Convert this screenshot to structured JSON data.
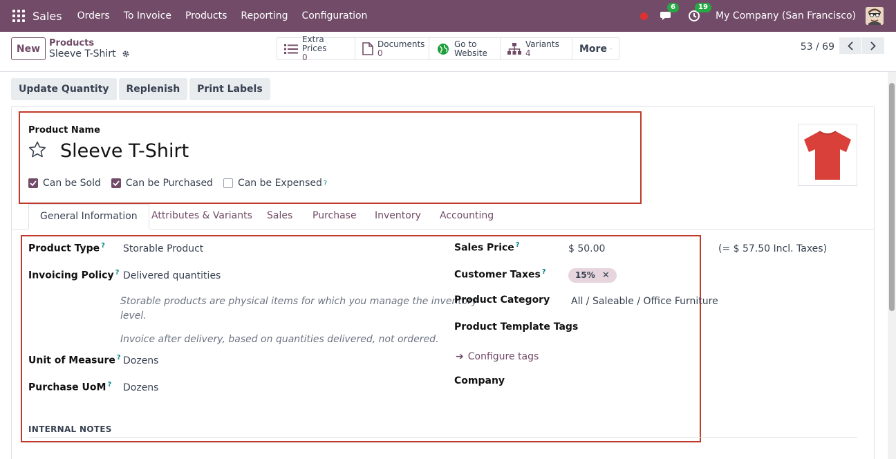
{
  "navbar": {
    "brand": "Sales",
    "menu": [
      "Orders",
      "To Invoice",
      "Products",
      "Reporting",
      "Configuration"
    ],
    "messages_count": "6",
    "activities_count": "19",
    "company": "My Company (San Francisco)"
  },
  "control": {
    "new_label": "New",
    "breadcrumb_parent": "Products",
    "breadcrumb_current": "Sleeve T-Shirt",
    "smart_buttons": [
      {
        "title": "Extra Prices",
        "value": "0",
        "icon": "list-icon"
      },
      {
        "title": "Documents",
        "value": "0",
        "icon": "file-icon"
      },
      {
        "title": "Go to",
        "value": "Website",
        "icon": "globe-icon"
      },
      {
        "title": "Variants",
        "value": "4",
        "icon": "sitemap-icon"
      }
    ],
    "more_label": "More",
    "pager": "53 / 69"
  },
  "statusbar": {
    "buttons": [
      "Update Quantity",
      "Replenish",
      "Print Labels"
    ]
  },
  "form": {
    "product_name_label": "Product Name",
    "product_name": "Sleeve T-Shirt",
    "checkboxes": [
      {
        "label": "Can be Sold",
        "checked": true
      },
      {
        "label": "Can be Purchased",
        "checked": true
      },
      {
        "label": "Can be Expensed",
        "checked": false
      }
    ],
    "help_marker": "?",
    "tabs": [
      "General Information",
      "Attributes & Variants",
      "Sales",
      "Purchase",
      "Inventory",
      "Accounting"
    ],
    "left": {
      "product_type_label": "Product Type",
      "product_type": "Storable Product",
      "invoicing_policy_label": "Invoicing Policy",
      "invoicing_policy": "Delivered quantities",
      "help_storable_1": "Storable products are physical items for which you manage the inventory",
      "help_storable_2": "level.",
      "help_invoice": "Invoice after delivery, based on quantities delivered, not ordered.",
      "uom_label": "Unit of Measure",
      "uom": "Dozens",
      "purchase_uom_label": "Purchase UoM",
      "purchase_uom": "Dozens"
    },
    "right": {
      "sales_price_label": "Sales Price",
      "sales_price": "$ 50.00",
      "incl_taxes": "(= $ 57.50 Incl. Taxes)",
      "customer_taxes_label": "Customer Taxes",
      "tax_tag": "15%",
      "product_category_label": "Product Category",
      "product_category": "All / Saleable / Office Furniture",
      "template_tags_label": "Product Template Tags",
      "configure_tags": "Configure tags",
      "company_label": "Company"
    },
    "internal_notes": "INTERNAL NOTES"
  },
  "colors": {
    "brand": "#714b67",
    "highlight_box": "#c0392b",
    "product_image": "#d9403a"
  }
}
